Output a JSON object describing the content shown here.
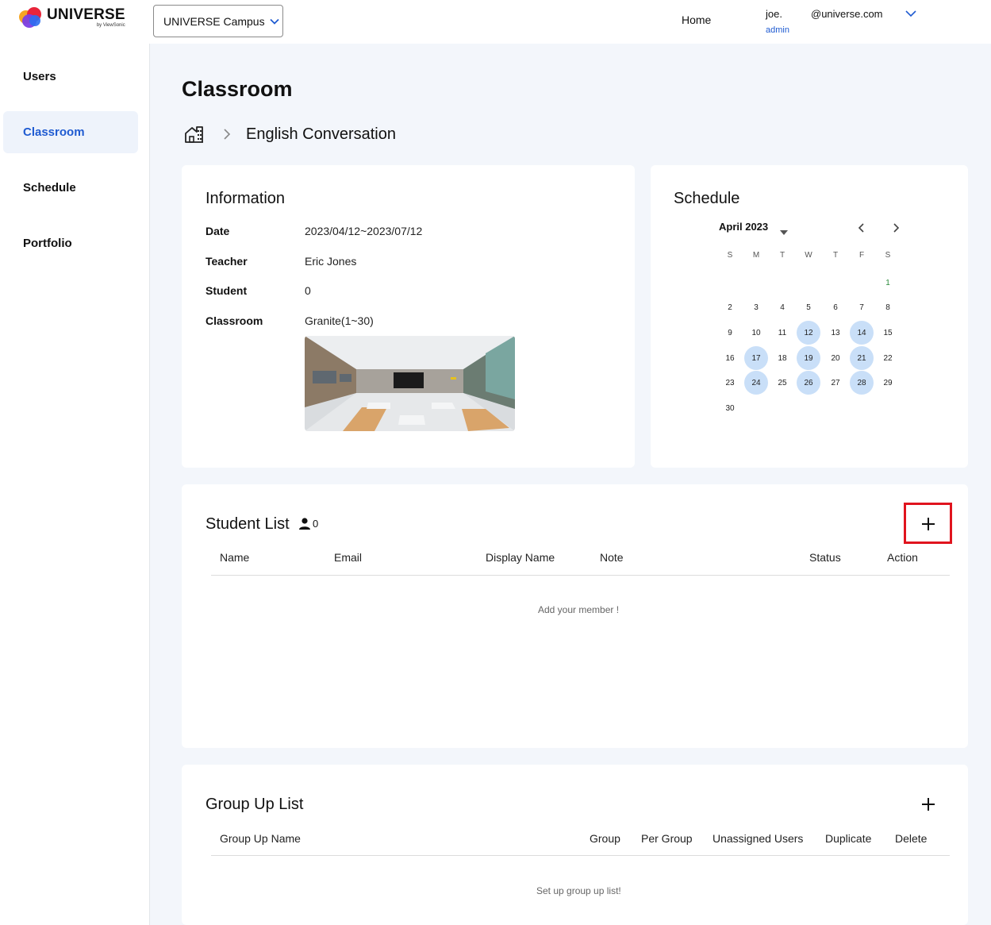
{
  "header": {
    "logo_text": "UNIVERSE",
    "logo_sub": "by ViewSonic",
    "campus_select": "UNIVERSE Campus",
    "nav_home": "Home",
    "user_name": "joe.",
    "user_role": "admin",
    "user_email": "@universe.com"
  },
  "sidebar": {
    "items": [
      {
        "label": "Users"
      },
      {
        "label": "Classroom",
        "active": true
      },
      {
        "label": "Schedule"
      },
      {
        "label": "Portfolio"
      }
    ]
  },
  "page": {
    "title": "Classroom",
    "breadcrumb_current": "English Conversation"
  },
  "information": {
    "title": "Information",
    "rows": [
      {
        "label": "Date",
        "value": "2023/04/12~2023/07/12"
      },
      {
        "label": "Teacher",
        "value": "Eric Jones"
      },
      {
        "label": "Student",
        "value": "0"
      },
      {
        "label": "Classroom",
        "value": "Granite(1~30)"
      }
    ]
  },
  "schedule": {
    "title": "Schedule",
    "month": "April 2023",
    "weekdays": [
      "S",
      "M",
      "T",
      "W",
      "T",
      "F",
      "S"
    ],
    "days": [
      "1",
      "2",
      "3",
      "4",
      "5",
      "6",
      "7",
      "8",
      "9",
      "10",
      "11",
      "12",
      "13",
      "14",
      "15",
      "16",
      "17",
      "18",
      "19",
      "20",
      "21",
      "22",
      "23",
      "24",
      "25",
      "26",
      "27",
      "28",
      "29",
      "30"
    ],
    "highlighted_days": [
      "12",
      "14",
      "17",
      "19",
      "21",
      "24",
      "26",
      "28"
    ]
  },
  "student_list": {
    "title": "Student List",
    "count": "0",
    "columns": [
      "Name",
      "Email",
      "Display Name",
      "Note",
      "Status",
      "Action"
    ],
    "empty_message": "Add your member !"
  },
  "group_list": {
    "title": "Group Up List",
    "columns": [
      "Group Up Name",
      "Group",
      "Per Group",
      "Unassigned Users",
      "Duplicate",
      "Delete"
    ],
    "empty_message": "Set up group up list!"
  },
  "colors": {
    "accent": "#1f5bd1",
    "background": "#f3f6fb",
    "calendar_highlight": "#c9dff8",
    "annotation_box": "#e0141e"
  }
}
